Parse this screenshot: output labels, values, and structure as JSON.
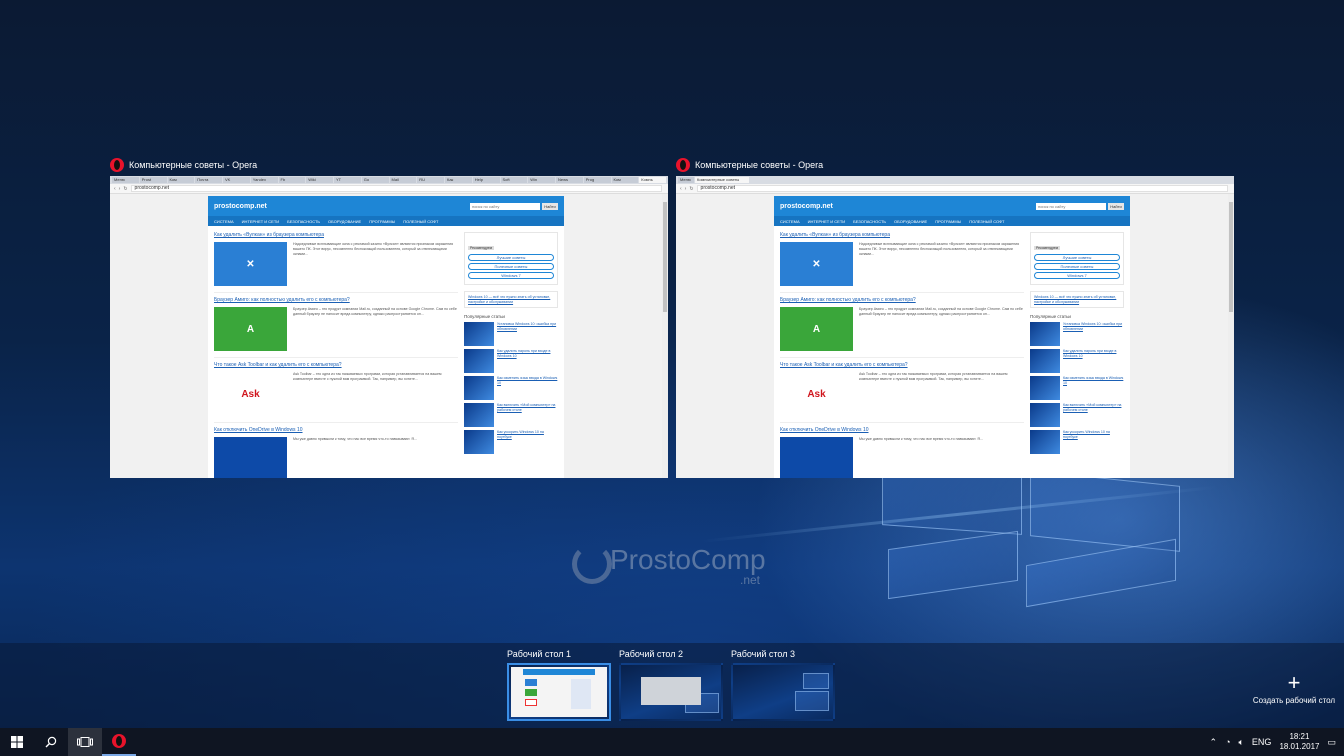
{
  "windows": [
    {
      "title": "Компьютерные советы - Opera",
      "tabs": [
        "Меню",
        "Prost",
        "Ком",
        "Почта",
        "VK",
        "Yandex",
        "Fb",
        "Wiki",
        "YT",
        "Go",
        "Mail",
        "RU",
        "Как",
        "Help",
        "Soft",
        "Win",
        "News",
        "Prog",
        "Ком",
        "Компь"
      ],
      "active_tab_index": 19
    },
    {
      "title": "Компьютерные советы - Opera",
      "tabs": [
        "Меню",
        "Компьютерные советы"
      ],
      "active_tab_index": 1
    }
  ],
  "browser": {
    "url": "prostocomp.net"
  },
  "site": {
    "logo": "prostocomp.net",
    "search_placeholder": "поиск по сайту",
    "search_button": "Найти",
    "nav": [
      "СИСТЕМА",
      "ИНТЕРНЕТ И СЕТИ",
      "БЕЗОПАСНОСТЬ",
      "ОБОРУДОВАНИЕ",
      "ПРОГРАММЫ",
      "ПОЛЕЗНЫЙ СОФТ"
    ],
    "articles": [
      {
        "title": "Как удалить «Вулкан» из браузера компьютера",
        "img_label": "✕",
        "img_color": "#2a7fd4",
        "text": "Надоедливые всплывающие окна с рекламой казино «Вулкан» являются признаком заражения вашего ПК. Этот вирус, несомненно беспокоящий пользователя, который за отвлекающими окнами..."
      },
      {
        "title": "Браузер Амиго: как полностью удалить его с компьютера?",
        "img_label": "A",
        "img_color": "#3aa63a",
        "text": "Браузер Амиго – это продукт компании Mail.ru, созданный на основе Google Chrome. Сам по себе данный браузер не наносит вреда компьютеру, однако распространяется он..."
      },
      {
        "title": "Что такое Ask Toolbar и как удалить его с компьютера?",
        "img_label": "Ask",
        "img_color": "#ffffff",
        "text": "Ask Toolbar – это одна из так называемых программ, которая устанавливается на вашем компьютере вместе с нужной вам программой. Так, например, вы хотите..."
      },
      {
        "title": "Как отключить OneDrive в Windows 10",
        "img_label": "",
        "img_color": "#0d4aa8",
        "text": "Мы уже давно привыкли к тому, что нас все время что-то навязывают. Я..."
      }
    ],
    "sidebar_tag": "Рекомендуем",
    "sidebar_pills": [
      "Лучшие советы",
      "Полезные советы",
      "Windows 7"
    ],
    "sidebar_note": "Windows 10 — всё что нужно знать об установке, настройке и обслуживании",
    "popular_heading": "Популярные статьи",
    "popular": [
      "Установка Windows 10: ошибка при обновлении",
      "Как удалить пароль при входе в Windows 10",
      "Как изменить язык ввода в Windows 10",
      "Как включить «Мой компьютер» на рабочем столе",
      "Как ускорить Windows 10 на ноутбуке"
    ]
  },
  "watermark": {
    "main": "ProstoComp",
    "suffix": ".net"
  },
  "desktops": [
    {
      "label": "Рабочий стол 1",
      "active": true
    },
    {
      "label": "Рабочий стол 2",
      "active": false
    },
    {
      "label": "Рабочий стол 3",
      "active": false
    }
  ],
  "new_desktop_label": "Создать рабочий стол",
  "taskbar": {
    "language": "ENG",
    "time": "18:21",
    "date": "18.01.2017"
  },
  "colors": {
    "accent": "#3a8ee6",
    "opera_red": "#e8132b",
    "site_blue": "#1e86d6"
  }
}
